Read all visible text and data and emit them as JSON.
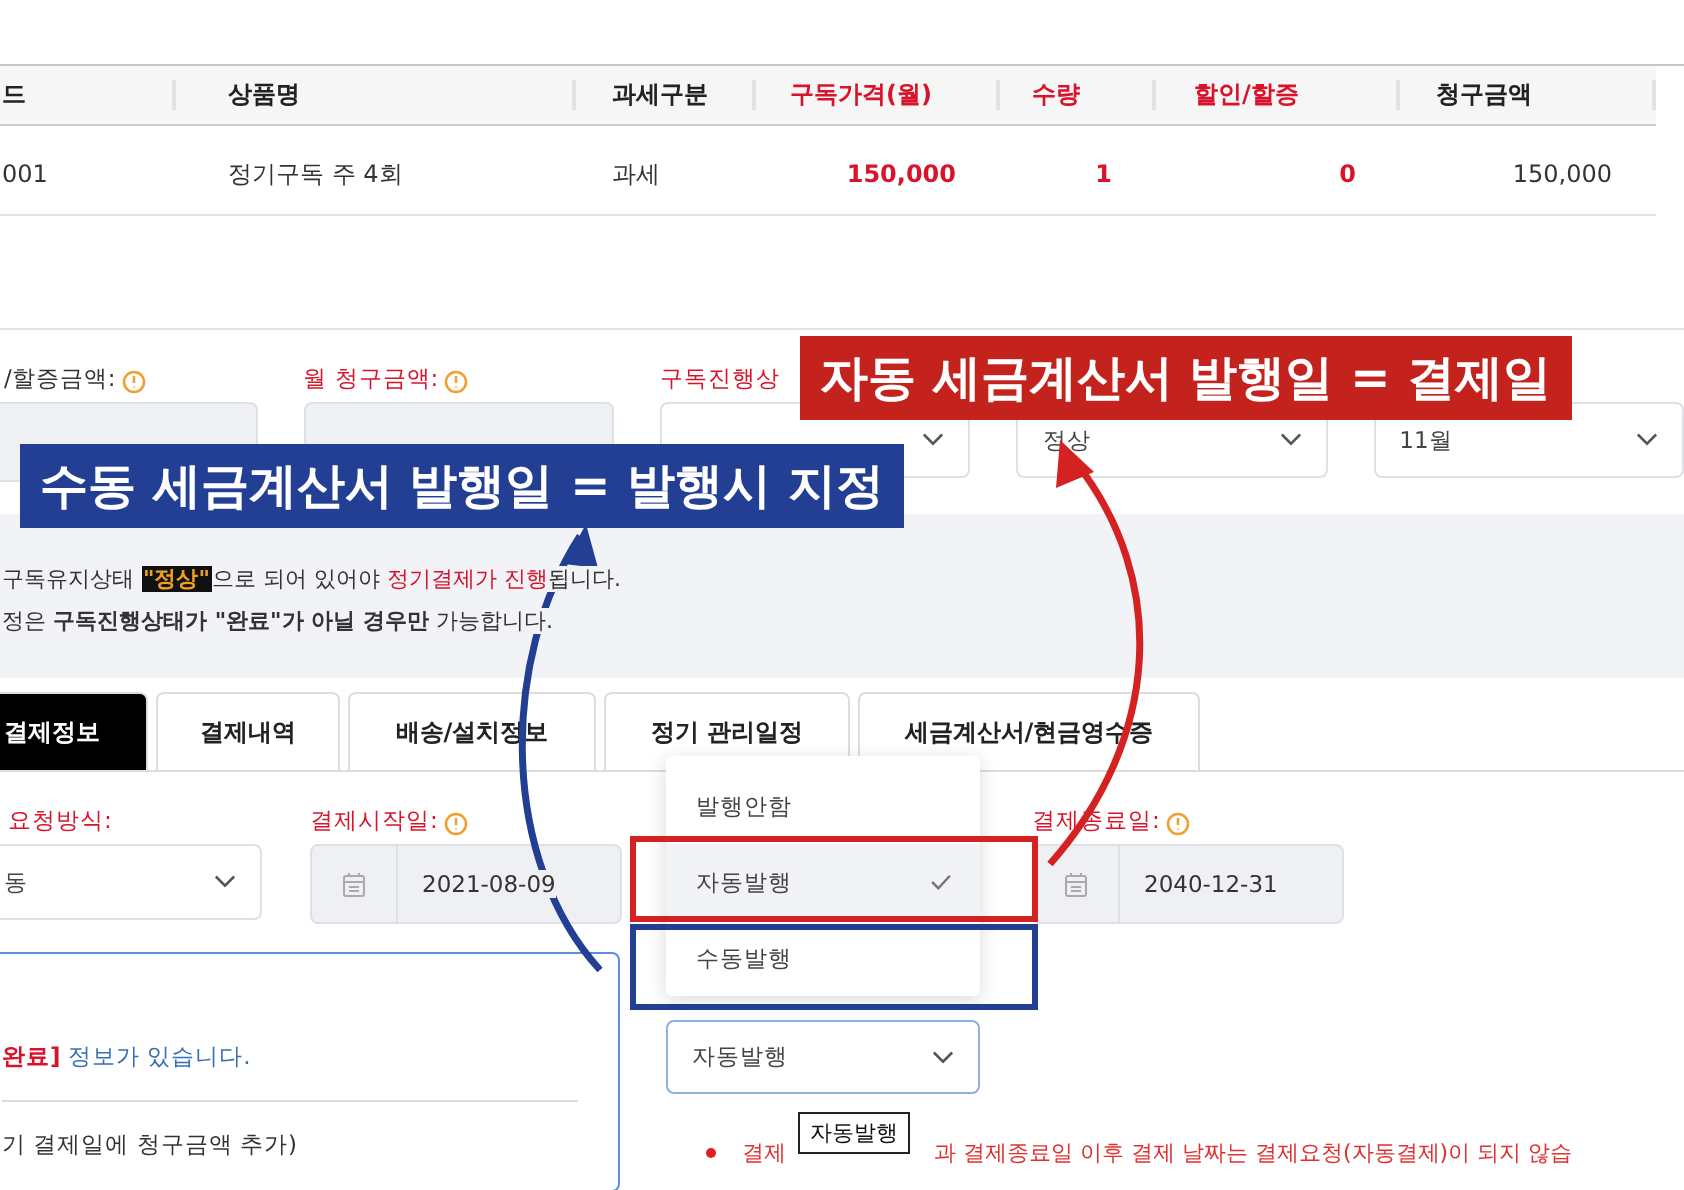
{
  "table": {
    "columns": [
      {
        "label": "드",
        "accent": false
      },
      {
        "label": "상품명",
        "accent": false
      },
      {
        "label": "과세구분",
        "accent": false
      },
      {
        "label": "구독가격(월)",
        "accent": true
      },
      {
        "label": "수량",
        "accent": true
      },
      {
        "label": "할인/할증",
        "accent": true
      },
      {
        "label": "청구금액",
        "accent": false
      }
    ],
    "rows": [
      [
        "001",
        "정기구독 주 4회",
        "과세",
        "150,000",
        "1",
        "0",
        "150,000"
      ]
    ]
  },
  "summary": {
    "fields": [
      {
        "kind": "input",
        "label": "/할증금액:",
        "info": true,
        "required": false
      },
      {
        "kind": "input",
        "label": "월 청구금액:",
        "info": true,
        "required": true
      },
      {
        "kind": "select",
        "label": "구독진행상",
        "info": false,
        "required": true
      },
      {
        "kind": "select",
        "value": "정상"
      },
      {
        "kind": "select",
        "value": "11월"
      }
    ]
  },
  "notice": [
    "구독유지상태 **\"정상\"**으로 되어 있어야 **정기결제가 진행**됩니다.",
    "정은 **구독진행상태가 \"완료\"가 아닐 경우만** 가능합니다."
  ],
  "tabs": [
    {
      "label": "결제정보",
      "selected": true
    },
    {
      "label": "결제내역",
      "selected": false
    },
    {
      "label": "배송/설치정보",
      "selected": false
    },
    {
      "label": "정기 관리일정",
      "selected": false
    },
    {
      "label": "세금계산서/현금영수증",
      "selected": false
    }
  ],
  "payment": {
    "fields": [
      {
        "kind": "select",
        "label": "요청방식:",
        "value": "동",
        "info": false
      },
      {
        "kind": "date",
        "label": "결제시작일:",
        "value": "2021-08-09",
        "info": true
      },
      {
        "kind": "date",
        "label": "결제종료일:",
        "value": "2040-12-31",
        "info": true
      }
    ]
  },
  "info_box": {
    "status": "완료]",
    "message": " 정보가 있습니다.",
    "line": "기 결제일에 청구금액 추가)"
  },
  "invoice_select": {
    "value": "자동발행",
    "tooltip": "자동발행",
    "options": [
      {
        "label": "발행안함",
        "selected": false
      },
      {
        "label": "자동발행",
        "selected": true
      },
      {
        "label": "수동발행",
        "selected": false
      }
    ]
  },
  "warning": [
    "결제",
    "과 결제종료일 이후 결제 날짜는 결제요청(자동결제)이 되지 않습"
  ],
  "annotations": [
    {
      "kind": "red",
      "text": "자동 세금계산서 발행일 = 결제일"
    },
    {
      "kind": "blue",
      "text": "수동 세금계산서 발행일 = 발행시 지정"
    }
  ]
}
